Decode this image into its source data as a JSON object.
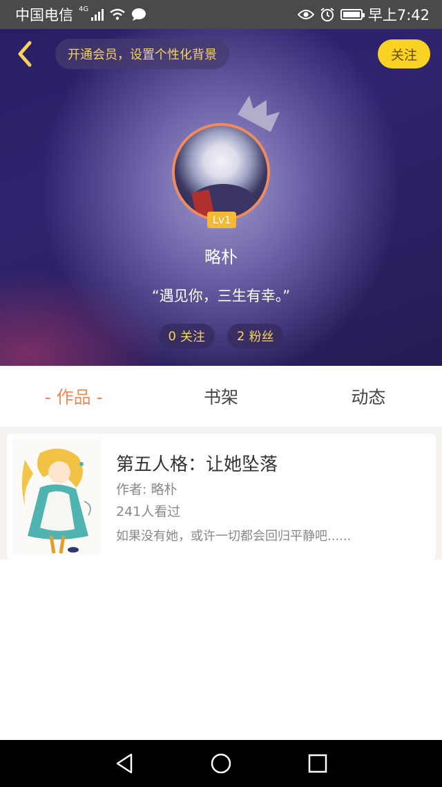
{
  "status_bar": {
    "carrier": "中国电信",
    "network": "4G",
    "time": "早上7:42",
    "icons": [
      "signal-icon",
      "wifi-icon",
      "message-icon",
      "eye-icon",
      "alarm-icon",
      "battery-icon"
    ]
  },
  "header": {
    "vip_prompt": "开通会员，设置个性化背景",
    "follow_label": "关注",
    "level": "Lv1",
    "username": "略朴",
    "signature": "“遇见你，三生有幸。”",
    "stats": [
      {
        "count": "0",
        "label": "关注"
      },
      {
        "count": "2",
        "label": "粉丝"
      }
    ]
  },
  "tabs": [
    {
      "label": "- 作品 -",
      "active": true
    },
    {
      "label": "书架",
      "active": false
    },
    {
      "label": "动态",
      "active": false
    }
  ],
  "books": [
    {
      "title": "第五人格：让她坠落",
      "author": "作者: 略朴",
      "views": "241人看过",
      "description": "如果没有她，或许一切都会回归平静吧......"
    }
  ],
  "colors": {
    "accent": "#ee8a55",
    "follow_button": "#f8d321",
    "stat_text": "#f6d35b",
    "status_bar": "#4a4a4a"
  }
}
